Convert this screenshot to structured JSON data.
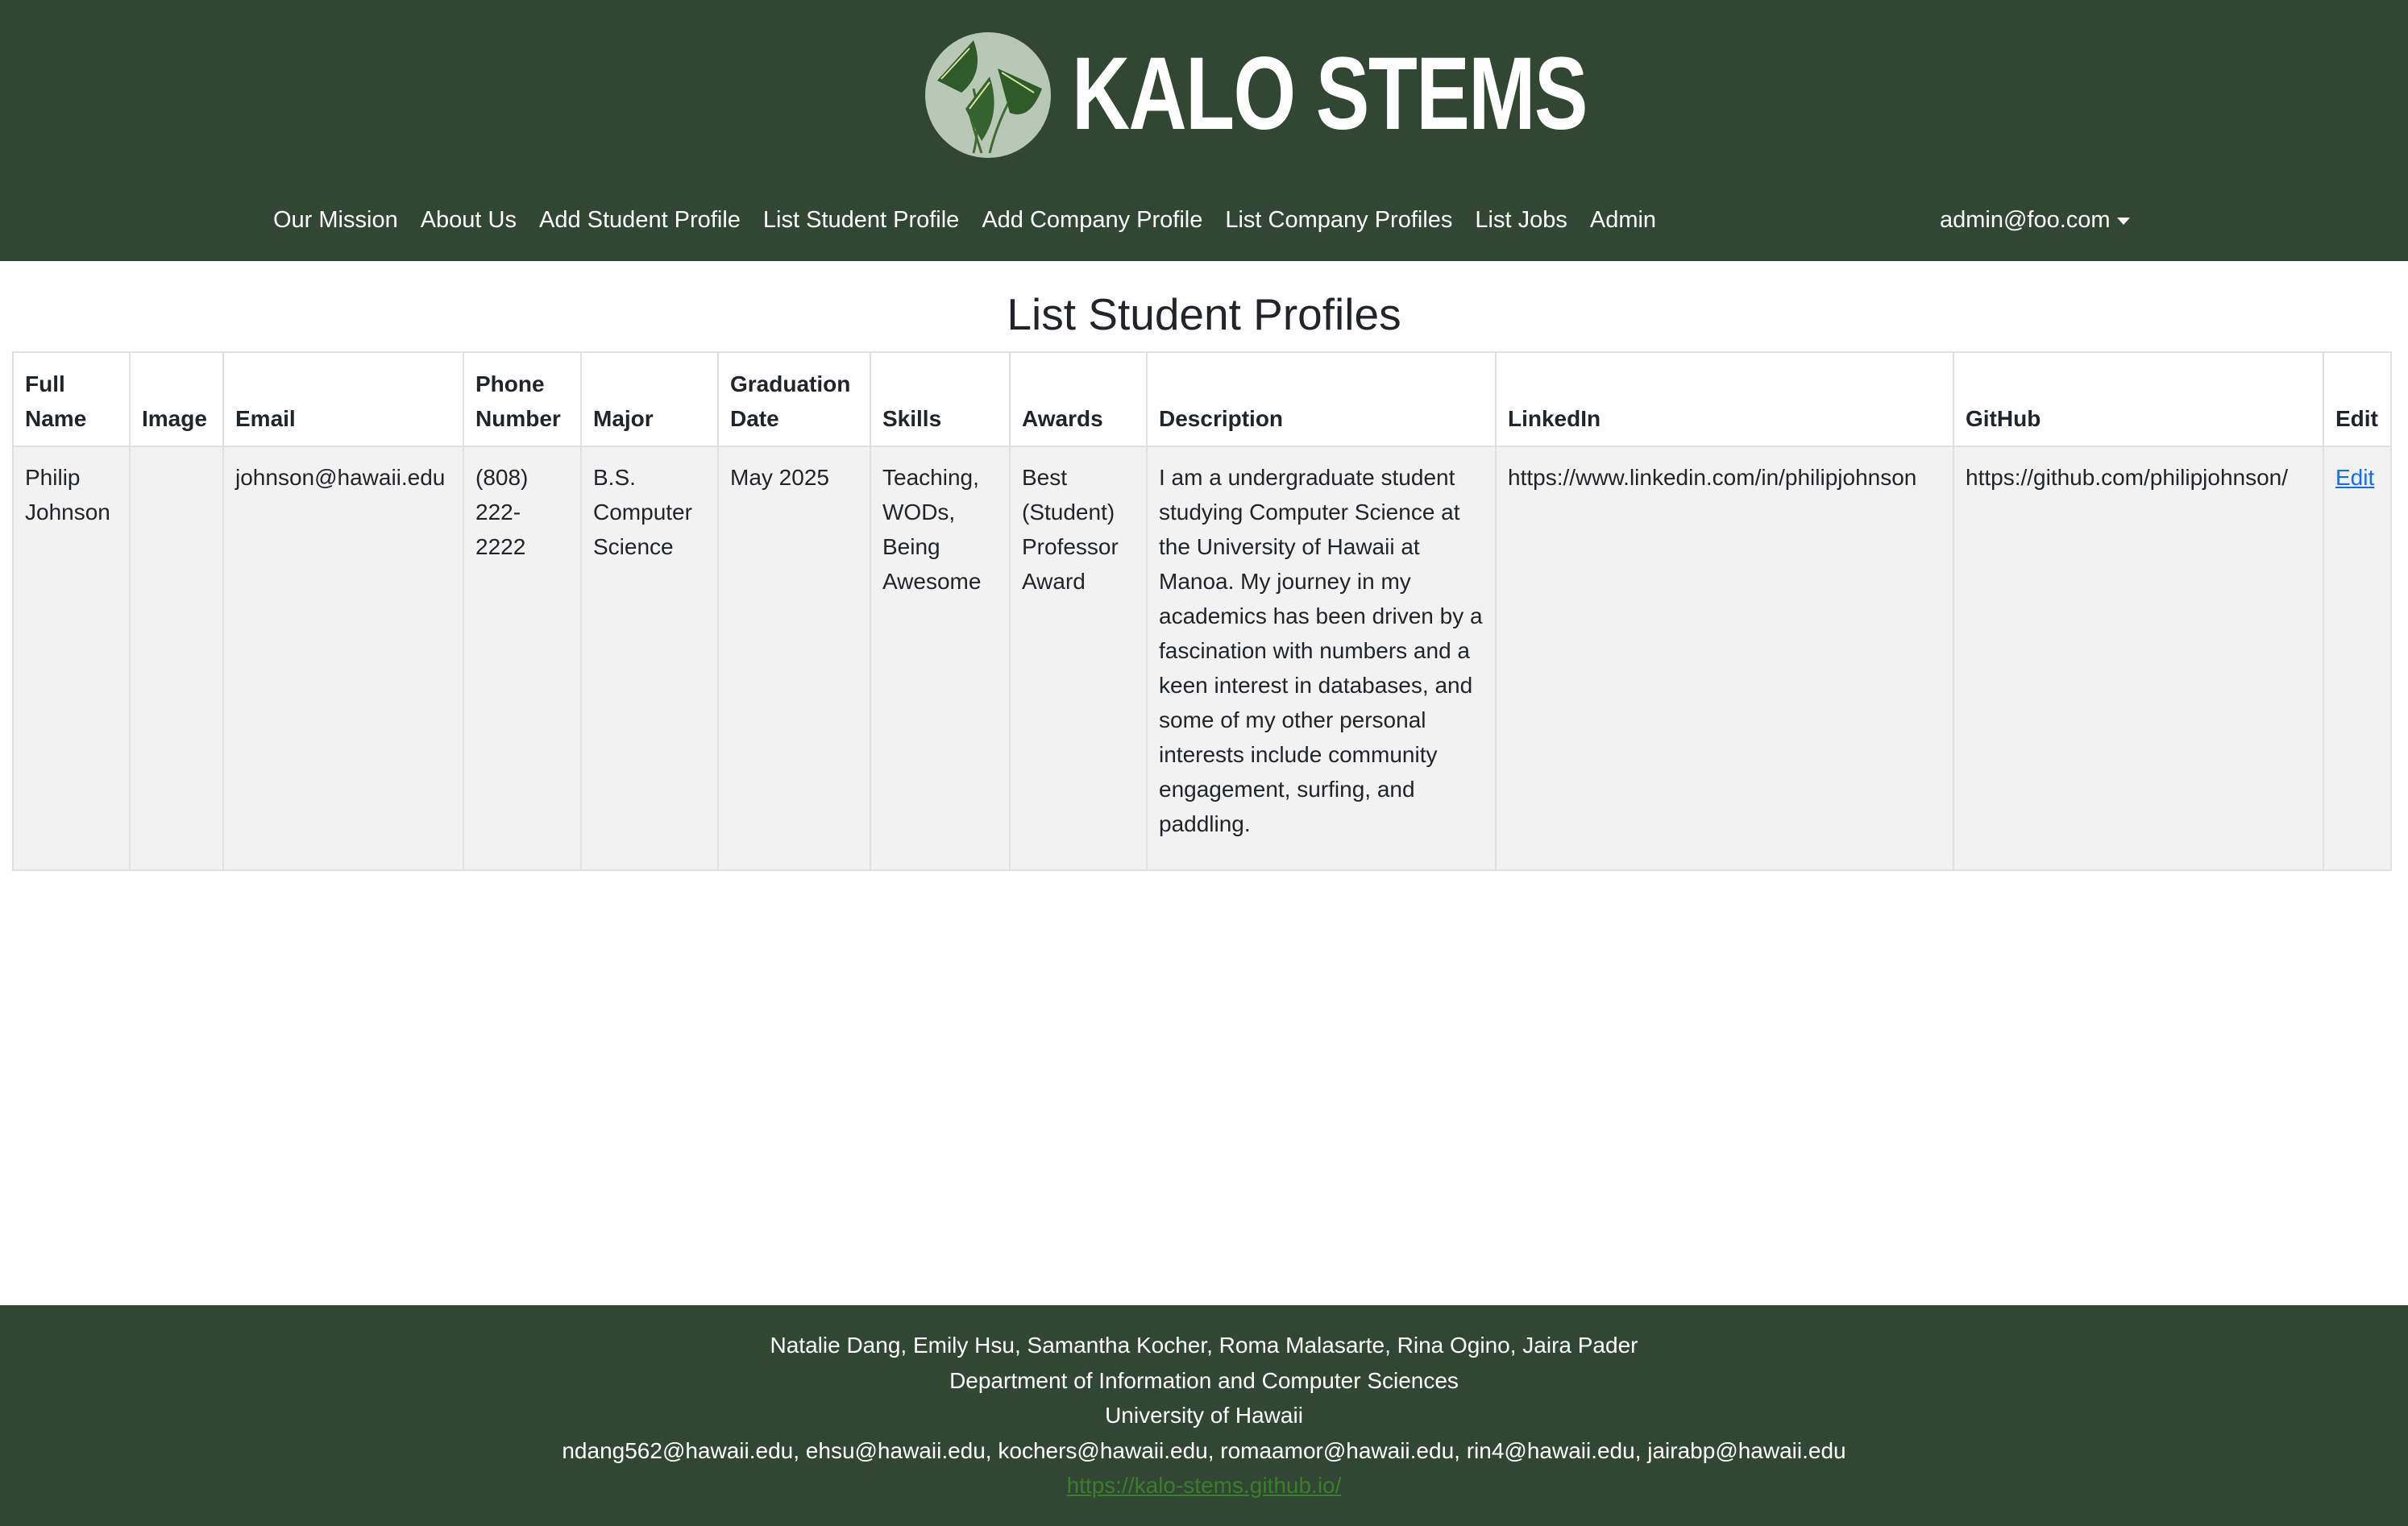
{
  "header": {
    "brand": "KALO STEMS",
    "logo_icon": "taro-leaf-logo-icon",
    "nav": [
      "Our Mission",
      "About Us",
      "Add Student Profile",
      "List Student Profile",
      "Add Company Profile",
      "List Company Profiles",
      "List Jobs",
      "Admin"
    ],
    "user": "admin@foo.com",
    "background_color": "#324733"
  },
  "page": {
    "title": "List Student Profiles"
  },
  "table": {
    "columns": [
      "Full Name",
      "Image",
      "Email",
      "Phone Number",
      "Major",
      "Graduation Date",
      "Skills",
      "Awards",
      "Description",
      "LinkedIn",
      "GitHub",
      "Edit"
    ],
    "rows": [
      {
        "full_name": "Philip Johnson",
        "image": "",
        "email": "johnson@hawaii.edu",
        "phone": "(808) 222-2222",
        "major": "B.S. Computer Science",
        "graduation": "May 2025",
        "skills": "Teaching, WODs, Being Awesome",
        "awards": "Best (Student) Professor Award",
        "description": "I am a undergraduate student studying Computer Science at the University of Hawaii at Manoa. My journey in my academics has been driven by a fascination with numbers and a keen interest in databases, and some of my other personal interests include community engagement, surfing, and paddling.",
        "linkedin": "https://www.linkedin.com/in/philipjohnson",
        "github": "https://github.com/philipjohnson/",
        "edit": "Edit"
      }
    ]
  },
  "footer": {
    "names": "Natalie Dang, Emily Hsu, Samantha Kocher, Roma Malasarte, Rina Ogino, Jaira Pader",
    "department": "Department of Information and Computer Sciences",
    "university": "University of Hawaii",
    "emails": "ndang562@hawaii.edu, ehsu@hawaii.edu, kochers@hawaii.edu, romaamor@hawaii.edu, rin4@hawaii.edu, jairabp@hawaii.edu",
    "link": "https://kalo-stems.github.io/"
  }
}
